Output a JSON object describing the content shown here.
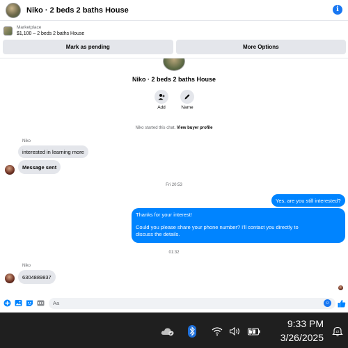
{
  "header": {
    "title": "Niko · 2 beds 2 baths House",
    "info_glyph": "i"
  },
  "listing": {
    "source": "Marketplace",
    "summary": "$1,100 – 2 beds 2 baths House"
  },
  "actions": {
    "mark_pending": "Mark as pending",
    "more_options": "More Options"
  },
  "profile": {
    "name": "Niko · 2 beds 2 baths House",
    "add_label": "Add",
    "name_label": "Name"
  },
  "system": {
    "started": "Niko started this chat.",
    "view_profile": "View buyer profile"
  },
  "messages": {
    "sender1": "Niko",
    "in1": "interested in learning more",
    "in2": "Message sent",
    "time1": "Fri 20:53",
    "out1": "Yes, are you still interested?",
    "out2_line1": "Thanks for your interest!",
    "out2_line2": "Could you please share your phone number? I'll contact you directly to",
    "out2_line3": "discuss the details.",
    "time2": "01:32",
    "sender2": "Niko",
    "in3": "6304889837"
  },
  "composer": {
    "placeholder": "Aa"
  },
  "taskbar": {
    "time": "9:33 PM",
    "date": "3/26/2025"
  },
  "colors": {
    "accent": "#0084ff",
    "bubble_in": "#e4e6eb",
    "taskbar": "#1f1f1f"
  }
}
